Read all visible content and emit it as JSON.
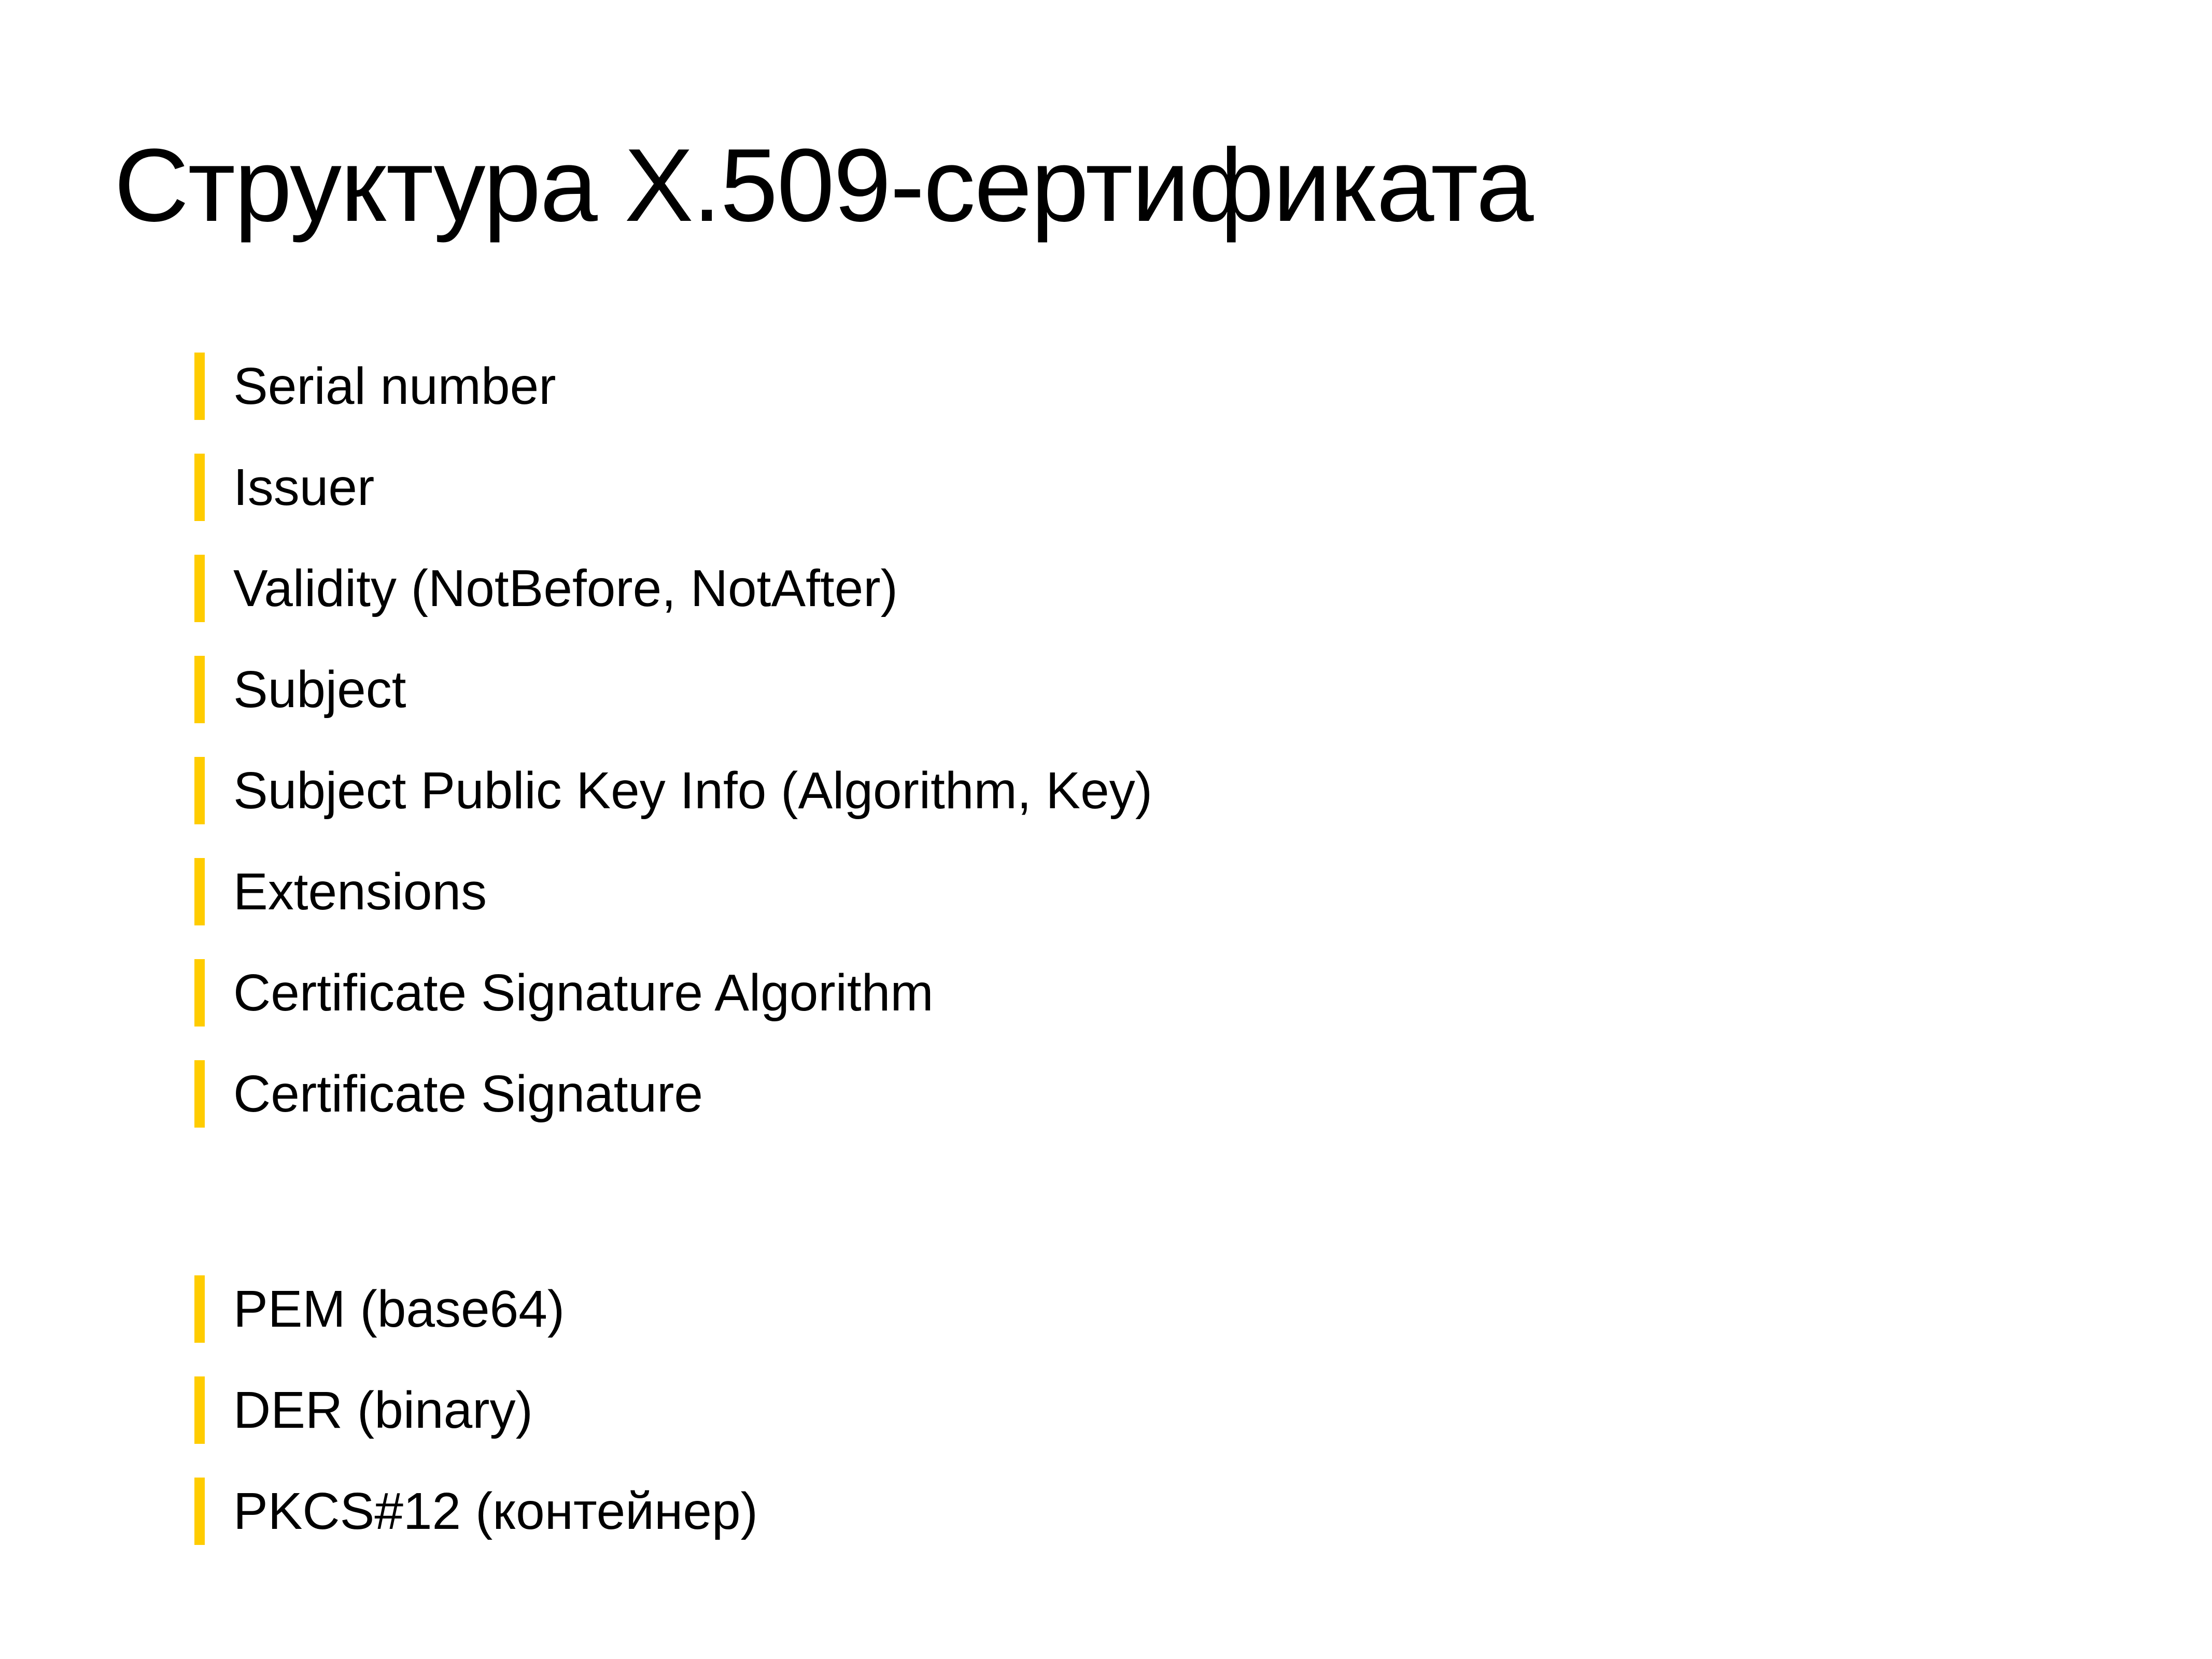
{
  "slide": {
    "title": "Структура X.509-сертификата",
    "accent_color": "#FFCC00",
    "fields": [
      "Serial number",
      "Issuer",
      "Validity (NotBefore, NotAfter)",
      "Subject",
      "Subject Public Key Info (Algorithm, Key)",
      "Extensions",
      "Certificate Signature Algorithm",
      "Certificate Signature"
    ],
    "formats": [
      "PEM (base64)",
      "DER (binary)",
      "PKCS#12 (контейнер)"
    ]
  }
}
